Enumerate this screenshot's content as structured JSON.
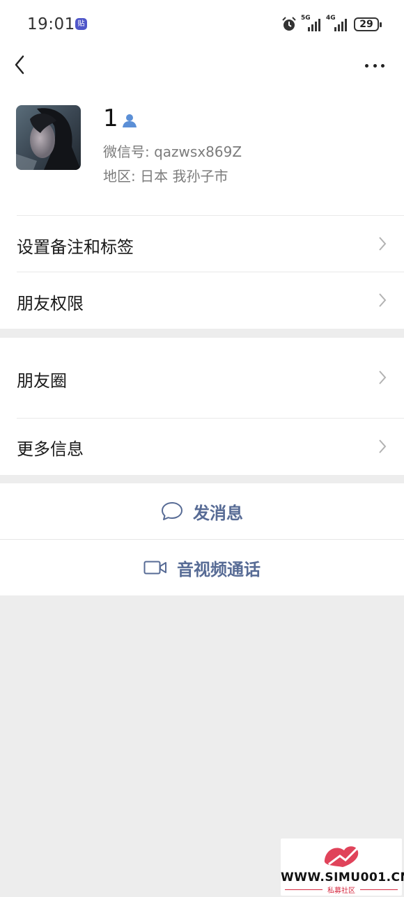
{
  "status_bar": {
    "time": "19:01",
    "app_badge": "贴",
    "signal_1_label": "5G",
    "signal_2_label": "4G",
    "battery": "29",
    "icons": [
      "alarm-icon",
      "signal-icon",
      "battery-icon"
    ]
  },
  "nav": {
    "back_icon": "chevron-left-icon",
    "more_icon": "more-horizontal-icon"
  },
  "profile": {
    "name": "1",
    "wechat_id": "微信号: qazwsx869Z",
    "region": "地区: 日本  我孙子市",
    "contact_icon": "contact-person-icon"
  },
  "menu": {
    "remark_tags": "设置备注和标签",
    "friend_permissions": "朋友权限",
    "moments": "朋友圈",
    "more_info": "更多信息"
  },
  "actions": {
    "send_message": "发消息",
    "video_call": "音视频通话"
  },
  "watermark": {
    "text": "WWW.SIMU001.CN",
    "sub": "私募社区"
  },
  "colors": {
    "link_blue": "#576b95",
    "background": "#ededed",
    "contact_icon_blue": "#5b8fd6"
  }
}
